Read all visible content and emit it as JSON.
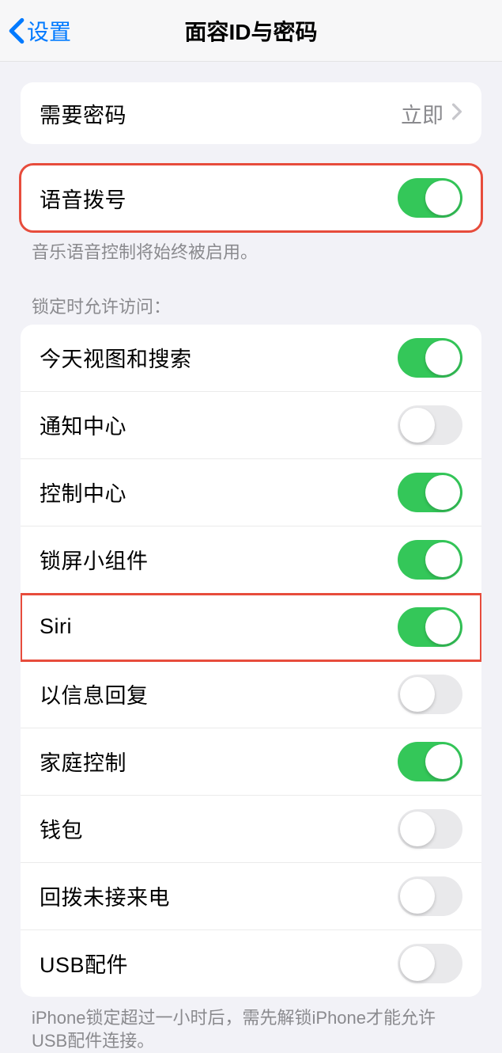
{
  "header": {
    "back_label": "设置",
    "title": "面容ID与密码"
  },
  "passcode_required": {
    "label": "需要密码",
    "value": "立即"
  },
  "voice_dial": {
    "label": "语音拨号",
    "footer": "音乐语音控制将始终被启用。",
    "state": "on"
  },
  "lock_access": {
    "header": "锁定时允许访问：",
    "items": [
      {
        "label": "今天视图和搜索",
        "state": "on"
      },
      {
        "label": "通知中心",
        "state": "off"
      },
      {
        "label": "控制中心",
        "state": "on"
      },
      {
        "label": "锁屏小组件",
        "state": "on"
      },
      {
        "label": "Siri",
        "state": "on"
      },
      {
        "label": "以信息回复",
        "state": "off"
      },
      {
        "label": "家庭控制",
        "state": "on"
      },
      {
        "label": "钱包",
        "state": "off"
      },
      {
        "label": "回拨未接来电",
        "state": "off"
      },
      {
        "label": "USB配件",
        "state": "off"
      }
    ],
    "footer": "iPhone锁定超过一小时后，需先解锁iPhone才能允许USB配件连接。"
  },
  "highlights": {
    "voice_dial_group": true,
    "siri_row_index": 4
  }
}
